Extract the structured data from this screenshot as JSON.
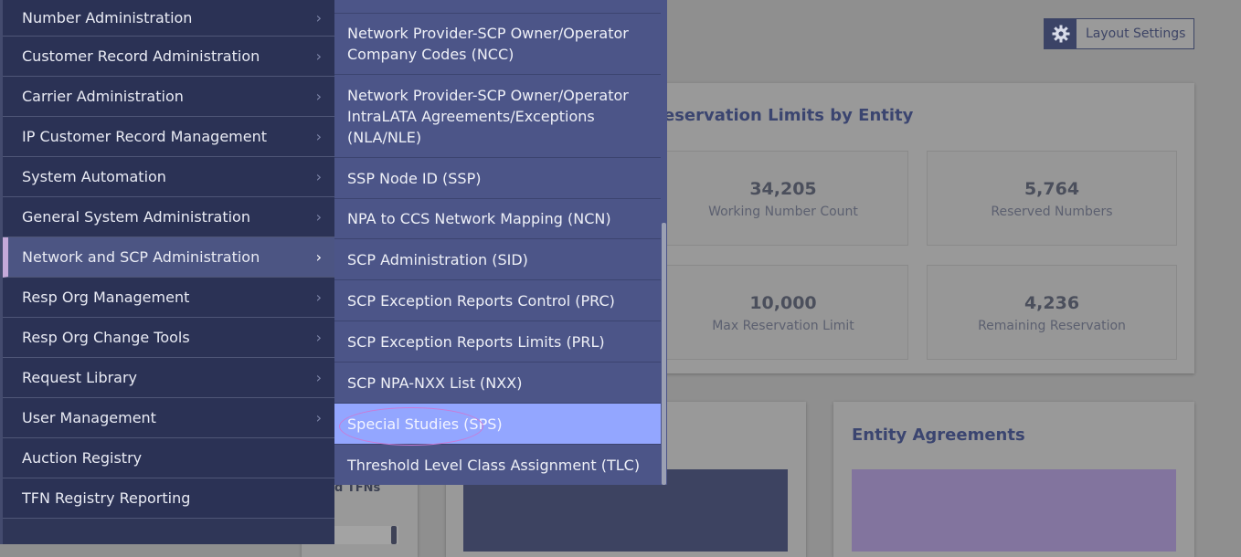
{
  "layout_settings": {
    "label": "Layout Settings",
    "icon": "gear-icon"
  },
  "reservation_card": {
    "title": "eservation Limits by Entity",
    "stats": [
      {
        "value": "34,205",
        "caption": "Working Number Count"
      },
      {
        "value": "5,764",
        "caption": "Reserved Numbers"
      },
      {
        "value": "10,000",
        "caption": "Max Reservation Limit"
      },
      {
        "value": "4,236",
        "caption": "Remaining Reservation"
      }
    ]
  },
  "agreements_card": {
    "title": "Entity Agreements"
  },
  "partial_card": {
    "text": "d TFNs"
  },
  "sidebar": {
    "items": [
      {
        "label": "Number Administration",
        "chevron": "›"
      },
      {
        "label": "Customer Record Administration",
        "chevron": "›"
      },
      {
        "label": "Carrier Administration",
        "chevron": "›"
      },
      {
        "label": "IP Customer Record Management",
        "chevron": "›"
      },
      {
        "label": "System Automation",
        "chevron": "›"
      },
      {
        "label": "General System Administration",
        "chevron": "›"
      },
      {
        "label": "Network and SCP Administration",
        "chevron": "›"
      },
      {
        "label": "Resp Org Management",
        "chevron": "›"
      },
      {
        "label": "Resp Org Change Tools",
        "chevron": "›"
      },
      {
        "label": "Request Library",
        "chevron": "›"
      },
      {
        "label": "User Management",
        "chevron": "›"
      },
      {
        "label": "Auction Registry",
        "chevron": ""
      },
      {
        "label": "TFN Registry Reporting",
        "chevron": ""
      }
    ]
  },
  "submenu": {
    "items": [
      {
        "label": "Network Provider-SCP Owner/Operator Company Codes (NCC)"
      },
      {
        "label": "Network Provider-SCP Owner/Operator IntraLATA Agreements/Exceptions (NLA/NLE)"
      },
      {
        "label": "SSP Node ID (SSP)"
      },
      {
        "label": "NPA to CCS Network Mapping (NCN)"
      },
      {
        "label": "SCP Administration (SID)"
      },
      {
        "label": "SCP Exception Reports Control (PRC)"
      },
      {
        "label": "SCP Exception Reports Limits (PRL)"
      },
      {
        "label": "SCP NPA-NXX List (NXX)"
      },
      {
        "label": "Special Studies (SPS)"
      },
      {
        "label": "Threshold Level Class Assignment (TLC)"
      }
    ]
  }
}
